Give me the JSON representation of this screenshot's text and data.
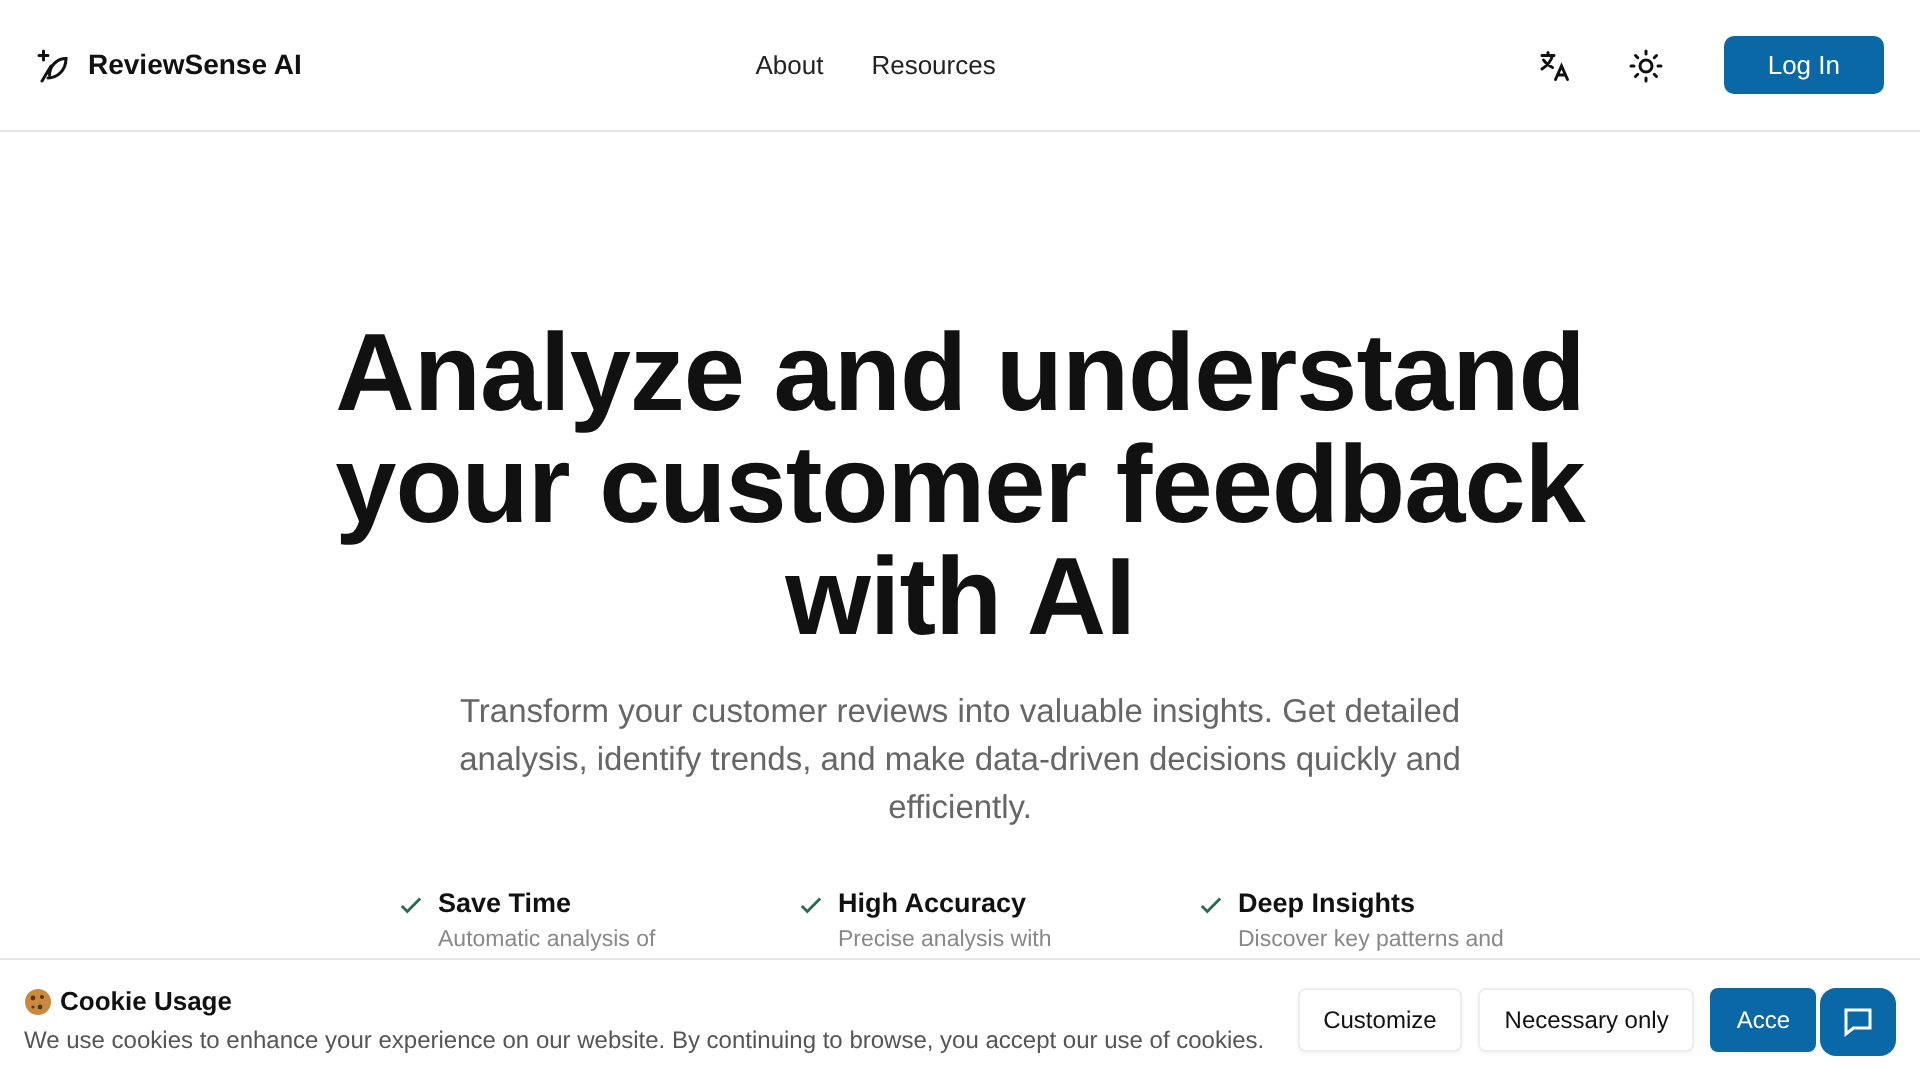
{
  "header": {
    "brand": "ReviewSense AI",
    "nav": [
      "About",
      "Resources"
    ],
    "login": "Log In"
  },
  "hero": {
    "title": "Analyze and understand your customer feedback with AI",
    "subtitle": "Transform your customer reviews into valuable insights. Get detailed analysis, identify trends, and make data-driven decisions quickly and efficiently."
  },
  "features": [
    {
      "title": "Save Time",
      "text": "Automatic analysis of"
    },
    {
      "title": "High Accuracy",
      "text": "Precise analysis with"
    },
    {
      "title": "Deep Insights",
      "text": "Discover key patterns and"
    }
  ],
  "cookie_banner": {
    "title": "Cookie Usage",
    "text": "We use cookies to enhance your experience on our website. By continuing to browse, you accept our use of cookies.",
    "buttons": [
      {
        "label": "Customize",
        "kind": "outline"
      },
      {
        "label": "Necessary only",
        "kind": "outline"
      },
      {
        "label": "Acce",
        "kind": "primary"
      }
    ]
  }
}
